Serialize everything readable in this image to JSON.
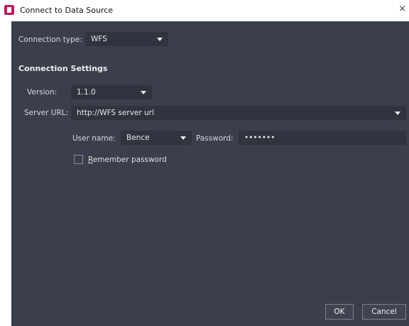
{
  "window": {
    "title": "Connect to Data Source",
    "close_glyph": "×"
  },
  "connection_type": {
    "label": "Connection type:",
    "value": "WFS"
  },
  "settings": {
    "section_title": "Connection Settings",
    "version_label": "Version:",
    "version_value": "1.1.0",
    "server_url_label": "Server URL:",
    "server_url_value": "http://WFS server url",
    "user_name_label": "User name:",
    "user_name_value": "Bence",
    "password_label": "Password:",
    "password_value": "•••••••",
    "remember_password_first": "R",
    "remember_password_rest": "emember password",
    "remember_password_checked": false
  },
  "buttons": {
    "ok_label": "OK",
    "cancel_label": "Cancel"
  },
  "colors": {
    "panel_background": "#3a3f4b",
    "field_background": "#2f343f",
    "app_icon": "#c2185b"
  }
}
